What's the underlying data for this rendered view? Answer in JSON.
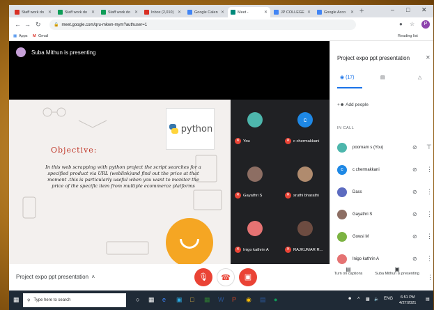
{
  "tabs": [
    {
      "label": "Staff work do",
      "icon": "gmail-icon",
      "color": "#d93025"
    },
    {
      "label": "Staff work do",
      "icon": "drive-icon",
      "color": "#0f9d58"
    },
    {
      "label": "Staff work do",
      "icon": "sheets-icon",
      "color": "#0f9d58"
    },
    {
      "label": "Inbox (2,010)",
      "icon": "gmail-icon",
      "color": "#d93025"
    },
    {
      "label": "Google Calen",
      "icon": "calendar-icon",
      "color": "#4285f4"
    },
    {
      "label": "Meet - ",
      "icon": "meet-icon",
      "color": "#00897b",
      "active": true
    },
    {
      "label": "JP COLLEGE",
      "icon": "doc-icon",
      "color": "#4285f4"
    },
    {
      "label": "Google Acco",
      "icon": "google-icon",
      "color": "#4285f4"
    }
  ],
  "address": {
    "url": "meet.google.com/qru-mkwn-mym?authuser=1"
  },
  "bookmarks": {
    "apps": "Apps",
    "gmail": "Gmail",
    "reading_list": "Reading list"
  },
  "presenter": {
    "text": "Suba Mithun is presenting"
  },
  "slide": {
    "logo_word": "python",
    "title": "Objective:",
    "body": "In this web scrapping with python project the script searches for a specified product via URL (weblink)and find out the price at that moment .this is particularly useful when you want to monitor the price of the specific item from multiple ecommerce platforms"
  },
  "tiles": [
    {
      "name": "You",
      "color": "#4db6ac"
    },
    {
      "name": "c chermakkani",
      "color": "#1e88e5",
      "initial": "c"
    },
    {
      "name": "Gayathri S",
      "color": "#8d6e63"
    },
    {
      "name": "sruthi bharathi",
      "color": "#b08b6e"
    },
    {
      "name": "Inigo kathrin A",
      "color": "#e57373"
    },
    {
      "name": "RAJKUMAR R...",
      "color": "#6d4c41"
    }
  ],
  "controls": {
    "meeting_title": "Project expo ppt presentation",
    "captions": "Turn on captions",
    "presenting": "Suba Mithun is presenting"
  },
  "panel": {
    "title": "Project expo ppt presentation",
    "people_count": "(17)",
    "add_people": "Add people",
    "in_call": "IN CALL",
    "people": [
      {
        "name": "poornam s (You)",
        "color": "#4db6ac"
      },
      {
        "name": "c chermakkani",
        "color": "#1e88e5",
        "initial": "c"
      },
      {
        "name": "Dass",
        "color": "#5c6bc0"
      },
      {
        "name": "Gayathri S",
        "color": "#8d6e63"
      },
      {
        "name": "Gowsi M",
        "color": "#7cb342"
      },
      {
        "name": "Inigo kathrin A",
        "color": "#e57373"
      }
    ]
  },
  "taskbar": {
    "search_placeholder": "Type here to search",
    "lang": "ENG",
    "time": "6:51 PM",
    "date": "4/27/2021"
  }
}
